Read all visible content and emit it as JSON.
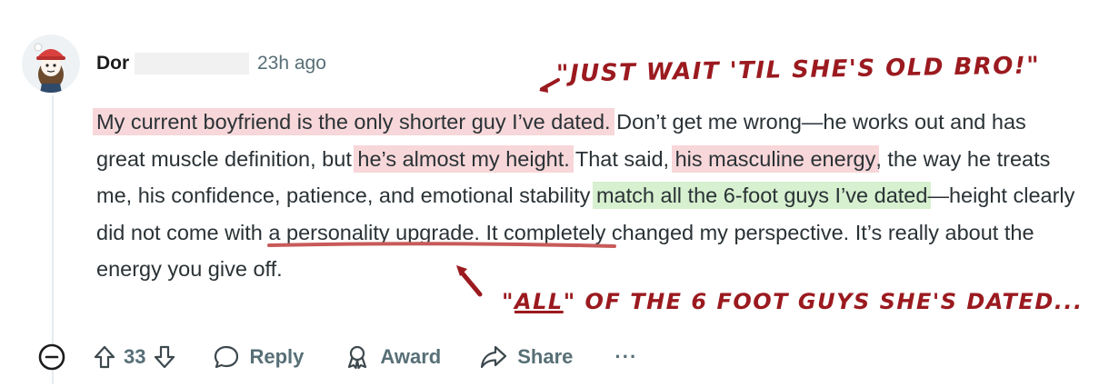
{
  "comment": {
    "author": "Dor",
    "timestamp": "23h ago",
    "body": {
      "s1": "My current boyfriend is the only shorter guy I’ve dated.",
      "s2": " Don’t get me wrong—he works out and has great muscle definition, but ",
      "s3": "he’s almost my height.",
      "s4": " That said, ",
      "s5": "his masculine energy",
      "s6": ", the way he treats me, his confidence, patience, and emotional stability ",
      "s7a": "match ",
      "s7b": "all the 6-foot guys I’ve dated",
      "s8": "—height clearly did not come with a personality upgrade. It completely changed my perspective. It’s really about the energy you give off."
    }
  },
  "annotations": {
    "top": "\"JUST WAIT 'TIL SHE'S OLD BRO!\"",
    "bottom_quote_open": "\"",
    "bottom_emph": "ALL",
    "bottom_rest": "\" OF THE 6 FOOT GUYS SHE'S DATED..."
  },
  "actions": {
    "vote_count": "33",
    "reply_label": "Reply",
    "award_label": "Award",
    "share_label": "Share",
    "more_label": "···"
  },
  "colors": {
    "annotation": "#9b1a1f",
    "highlight_red": "#f7d7d9",
    "highlight_green": "#d7f0cf",
    "underline": "#c85a5a"
  }
}
